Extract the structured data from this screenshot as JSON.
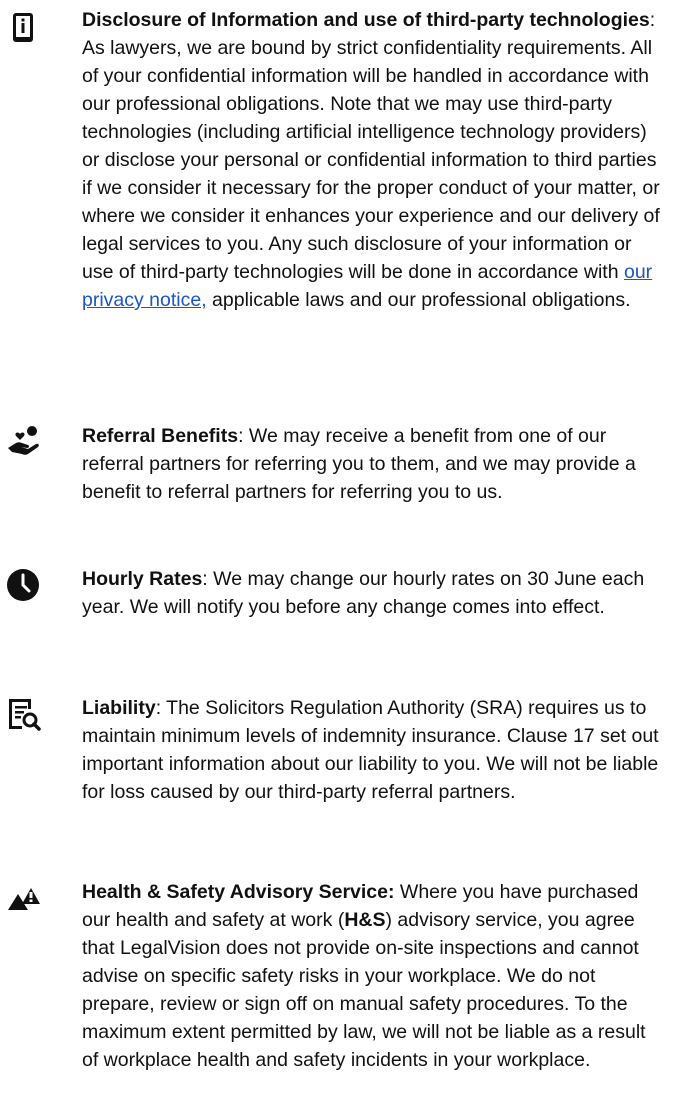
{
  "sections": [
    {
      "icon": "info-phone-icon",
      "title": "Disclosure of Information and use of third-party technologies",
      "separator": ": ",
      "body_before_link": "As lawyers, we are bound by strict confidentiality requirements. All of your confidential information will be handled in accordance with our professional obligations. Note that we may use third-party technologies (including artificial intelligence technology providers) or disclose your personal or confidential information to third parties if we consider it necessary for the proper conduct of your matter, or where we consider it enhances your experience and our delivery of legal services to you. Any such disclosure of your information or use of third-party technologies will be done in accordance with ",
      "link_text": "our privacy notice,",
      "body_after_link": " applicable laws and our professional obligations."
    },
    {
      "icon": "hand-heart-icon",
      "title": "Referral Benefits",
      "separator": ": ",
      "body": "We may receive a benefit from one of our referral partners for referring you to them, and we may provide a benefit to referral partners for referring you to us."
    },
    {
      "icon": "clock-icon",
      "title": "Hourly Rates",
      "separator": ": ",
      "body": "We may change our hourly rates on 30 June each year. We will notify you before any change comes into effect."
    },
    {
      "icon": "document-search-icon",
      "title": "Liability",
      "separator": ": ",
      "body": "The Solicitors Regulation Authority (SRA) requires us to maintain minimum levels of indemnity insurance. Clause 17 set out important information about our liability to you. We will not be liable for loss caused by our third-party referral partners."
    },
    {
      "icon": "warning-hazard-icon",
      "title": "Health & Safety Advisory Service:",
      "separator": " ",
      "body_before_bold": "Where you have purchased our health and safety at work (",
      "bold_inline": "H&S",
      "body_after_bold": ") advisory service, you agree that LegalVision does not provide on-site inspections and cannot advise on specific safety risks in your workplace. We do not prepare, review or sign off on manual safety procedures. To the maximum extent permitted by law, we will not be liable as a result of workplace health and safety incidents in your workplace."
    }
  ]
}
